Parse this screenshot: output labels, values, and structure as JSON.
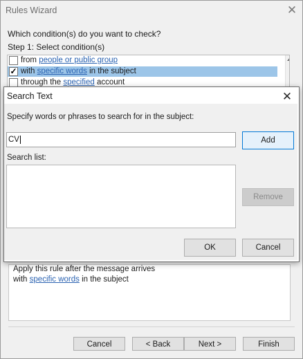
{
  "wizard": {
    "title": "Rules Wizard",
    "question": "Which condition(s) do you want to check?",
    "step1": "Step 1: Select condition(s)",
    "conditions": [
      {
        "checked": false,
        "pre": "from ",
        "link": "people or public group",
        "post": ""
      },
      {
        "checked": true,
        "pre": "with ",
        "link": "specific words",
        "post": " in the subject"
      },
      {
        "checked": false,
        "pre": "through the ",
        "link": "specified",
        "post": " account"
      }
    ],
    "description": {
      "line1": "Apply this rule after the message arrives",
      "line2_pre": "with ",
      "line2_link": "specific words",
      "line2_post": " in the subject"
    },
    "buttons": {
      "cancel": "Cancel",
      "back": "< Back",
      "next": "Next >",
      "finish": "Finish"
    }
  },
  "search_dialog": {
    "title": "Search Text",
    "prompt": "Specify words or phrases to search for in the subject:",
    "input_value": "CV",
    "search_list_label": "Search list:",
    "search_list_items": [],
    "buttons": {
      "add": "Add",
      "remove": "Remove",
      "ok": "OK",
      "cancel": "Cancel"
    }
  },
  "colors": {
    "selection": "#9cc5e8",
    "link": "#2a62b1",
    "default_button_border": "#0078d7"
  }
}
